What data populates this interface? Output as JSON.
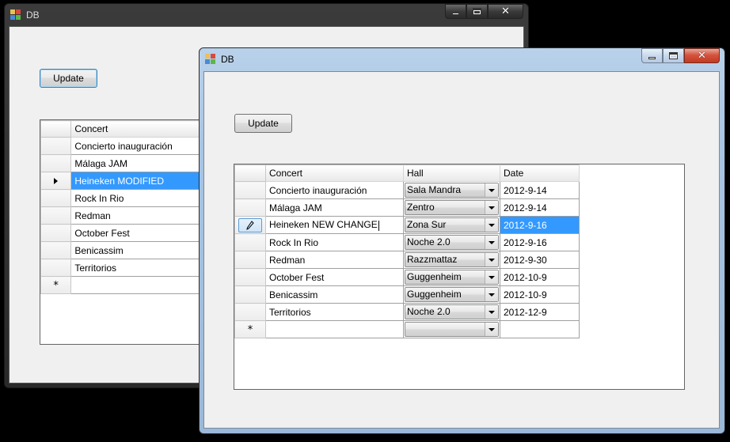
{
  "back_window": {
    "title": "DB",
    "update_label": "Update",
    "columns": [
      "Concert"
    ],
    "rows": [
      {
        "concert": "Concierto inauguración"
      },
      {
        "concert": "Málaga JAM"
      },
      {
        "concert": "Heineken MODIFIED"
      },
      {
        "concert": "Rock In Rio"
      },
      {
        "concert": "Redman"
      },
      {
        "concert": "October Fest"
      },
      {
        "concert": "Benicassim"
      },
      {
        "concert": "Territorios"
      }
    ],
    "current_row_index": 2,
    "new_row_marker": "*"
  },
  "front_window": {
    "title": "DB",
    "update_label": "Update",
    "columns": [
      "Concert",
      "Hall",
      "Date"
    ],
    "rows": [
      {
        "concert": "Concierto inauguración",
        "hall": "Sala Mandra",
        "date": "2012-9-14"
      },
      {
        "concert": "Málaga JAM",
        "hall": "Zentro",
        "date": "2012-9-14"
      },
      {
        "concert": "Heineken NEW CHANGE",
        "hall": "Zona Sur",
        "date": "2012-9-16"
      },
      {
        "concert": "Rock In Rio",
        "hall": "Noche 2.0",
        "date": "2012-9-16"
      },
      {
        "concert": "Redman",
        "hall": "Razzmattaz",
        "date": "2012-9-30"
      },
      {
        "concert": "October Fest",
        "hall": "Guggenheim",
        "date": "2012-10-9"
      },
      {
        "concert": "Benicassim",
        "hall": "Guggenheim",
        "date": "2012-10-9"
      },
      {
        "concert": "Territorios",
        "hall": "Noche 2.0",
        "date": "2012-12-9"
      }
    ],
    "editing_row_index": 2,
    "new_row_marker": "*",
    "new_row_hall": ""
  },
  "colors": {
    "selection": "#3399ff",
    "client_bg": "#f0f0f0",
    "close_button": "#c13a22"
  },
  "icons": {
    "app": "app-icon",
    "minimize": "minimize-icon",
    "maximize": "maximize-icon",
    "close": "close-icon",
    "current_row": "row-pointer-icon",
    "edit_row": "pencil-icon",
    "new_row": "new-row-star-icon",
    "combo": "chevron-down-icon"
  }
}
